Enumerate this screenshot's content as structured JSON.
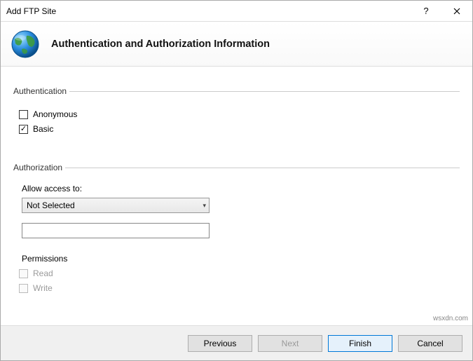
{
  "titlebar": {
    "title": "Add FTP Site"
  },
  "header": {
    "title": "Authentication and Authorization Information"
  },
  "auth": {
    "legend": "Authentication",
    "anonymous": {
      "label": "Anonymous",
      "checked": false
    },
    "basic": {
      "label": "Basic",
      "checked": true
    }
  },
  "authorization": {
    "legend": "Authorization",
    "allow_label": "Allow access to:",
    "selected": "Not Selected",
    "text_value": "",
    "permissions_label": "Permissions",
    "read": {
      "label": "Read",
      "checked": false,
      "enabled": false
    },
    "write": {
      "label": "Write",
      "checked": false,
      "enabled": false
    }
  },
  "footer": {
    "previous": "Previous",
    "next": "Next",
    "finish": "Finish",
    "cancel": "Cancel"
  },
  "watermark": "wsxdn.com"
}
